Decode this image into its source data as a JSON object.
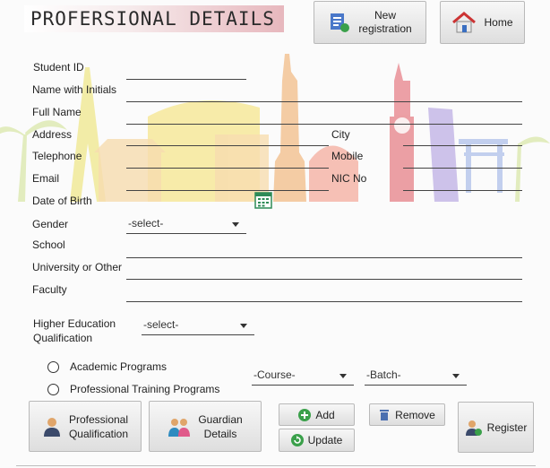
{
  "header": {
    "title": "PROFERSIONAL DETAILS",
    "new_registration": "New\nregistration",
    "home": "Home"
  },
  "form": {
    "student_id": "Student ID",
    "name_initials": "Name with Initials",
    "full_name": "Full Name",
    "address": "Address",
    "city": "City",
    "telephone": "Telephone",
    "mobile": "Mobile",
    "email": "Email",
    "nic": "NIC No",
    "dob": "Date of Birth",
    "gender": "Gender",
    "gender_value": "-select-",
    "school": "School",
    "university": "University or Other",
    "faculty": "Faculty",
    "higher_edu": "Higher Education\nQualification",
    "higher_edu_value": "-select-",
    "academic": "Academic Programs",
    "professional_training": "Professional Training Programs",
    "course_value": "-Course-",
    "batch_value": "-Batch-"
  },
  "actions": {
    "professional_qualification": "Professional\nQualification",
    "guardian_details": "Guardian\nDetails",
    "add": "Add",
    "update": "Update",
    "remove": "Remove",
    "register": "Register"
  },
  "colors": {
    "title_gradient_end": "#e7b7bd",
    "accent_green": "#2e8b57"
  }
}
